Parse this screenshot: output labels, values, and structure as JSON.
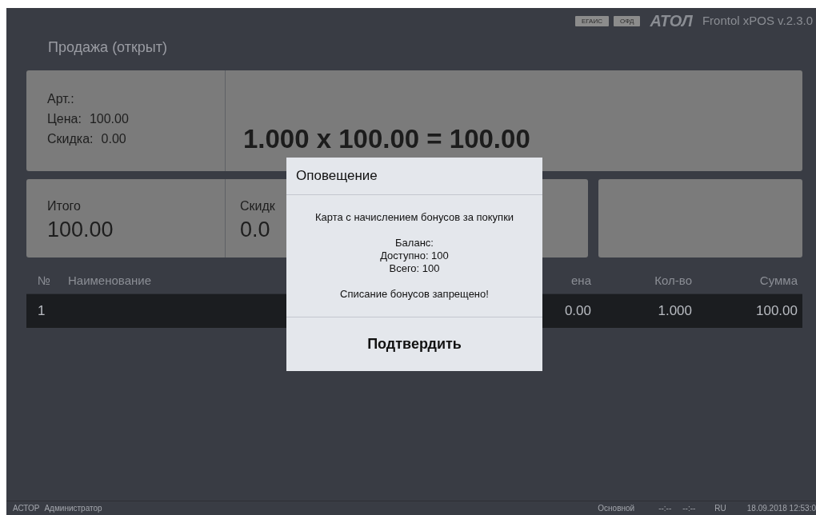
{
  "header": {
    "badges": [
      "ЕГАИС",
      "ОФД"
    ],
    "logo": "АТОЛ",
    "version": "Frontol xPOS v.2.3.0"
  },
  "title": "Продажа (открыт)",
  "item_card": {
    "lines": [
      {
        "label": "Арт.:"
      },
      {
        "label": "Цена:",
        "value": "100.00"
      },
      {
        "label": "Скидка:",
        "value": "0.00"
      }
    ],
    "formula": "1.000 x 100.00 = 100.00"
  },
  "totals": [
    {
      "label": "Итого",
      "value": "100.00"
    },
    {
      "label": "Скидк",
      "value": "0.0"
    }
  ],
  "table": {
    "columns": [
      "№",
      "Наименование",
      "ена",
      "Кол-во",
      "Сумма"
    ],
    "rows": [
      {
        "selected": true,
        "cells": [
          "1",
          "",
          "0.00",
          "1.000",
          "100.00"
        ]
      }
    ]
  },
  "dialog": {
    "title": "Оповещение",
    "paragraphs": [
      [
        "Карта с начислением бонусов за покупки"
      ],
      [
        "Баланс:",
        "Доступно: 100",
        "Всего: 100"
      ],
      [
        "Списание бонусов запрещено!"
      ]
    ],
    "button": "Подтвердить"
  },
  "status_bar": {
    "left": [
      "АСТОР",
      "Администратор"
    ],
    "right": [
      "Основной",
      "--:--",
      "--:--",
      "RU",
      "18.09.2018 12:53:0"
    ]
  }
}
